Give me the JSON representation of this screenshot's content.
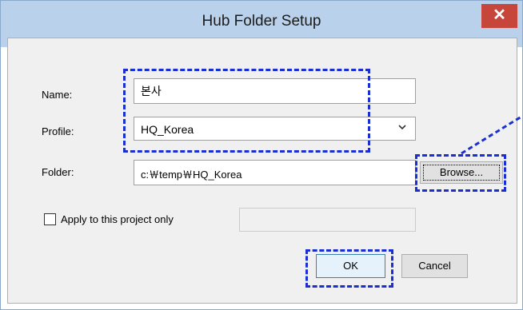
{
  "dialog": {
    "title": "Hub Folder Setup",
    "close_glyph": "✕"
  },
  "form": {
    "name_label": "Name:",
    "name_value": "본사",
    "profile_label": "Profile:",
    "profile_value": "HQ_Korea",
    "folder_label": "Folder:",
    "folder_value": "c:￦temp￦HQ_Korea",
    "browse_label": "Browse...",
    "apply_label": "Apply to this project only",
    "apply_checked": false
  },
  "buttons": {
    "ok_label": "OK",
    "cancel_label": "Cancel"
  },
  "colors": {
    "title_bar": "#b9d1ea",
    "close_button": "#c7463b",
    "annotation_highlight": "#1a2fd1"
  },
  "icons": {
    "close": "close-icon",
    "dropdown": "chevron-down-icon"
  }
}
